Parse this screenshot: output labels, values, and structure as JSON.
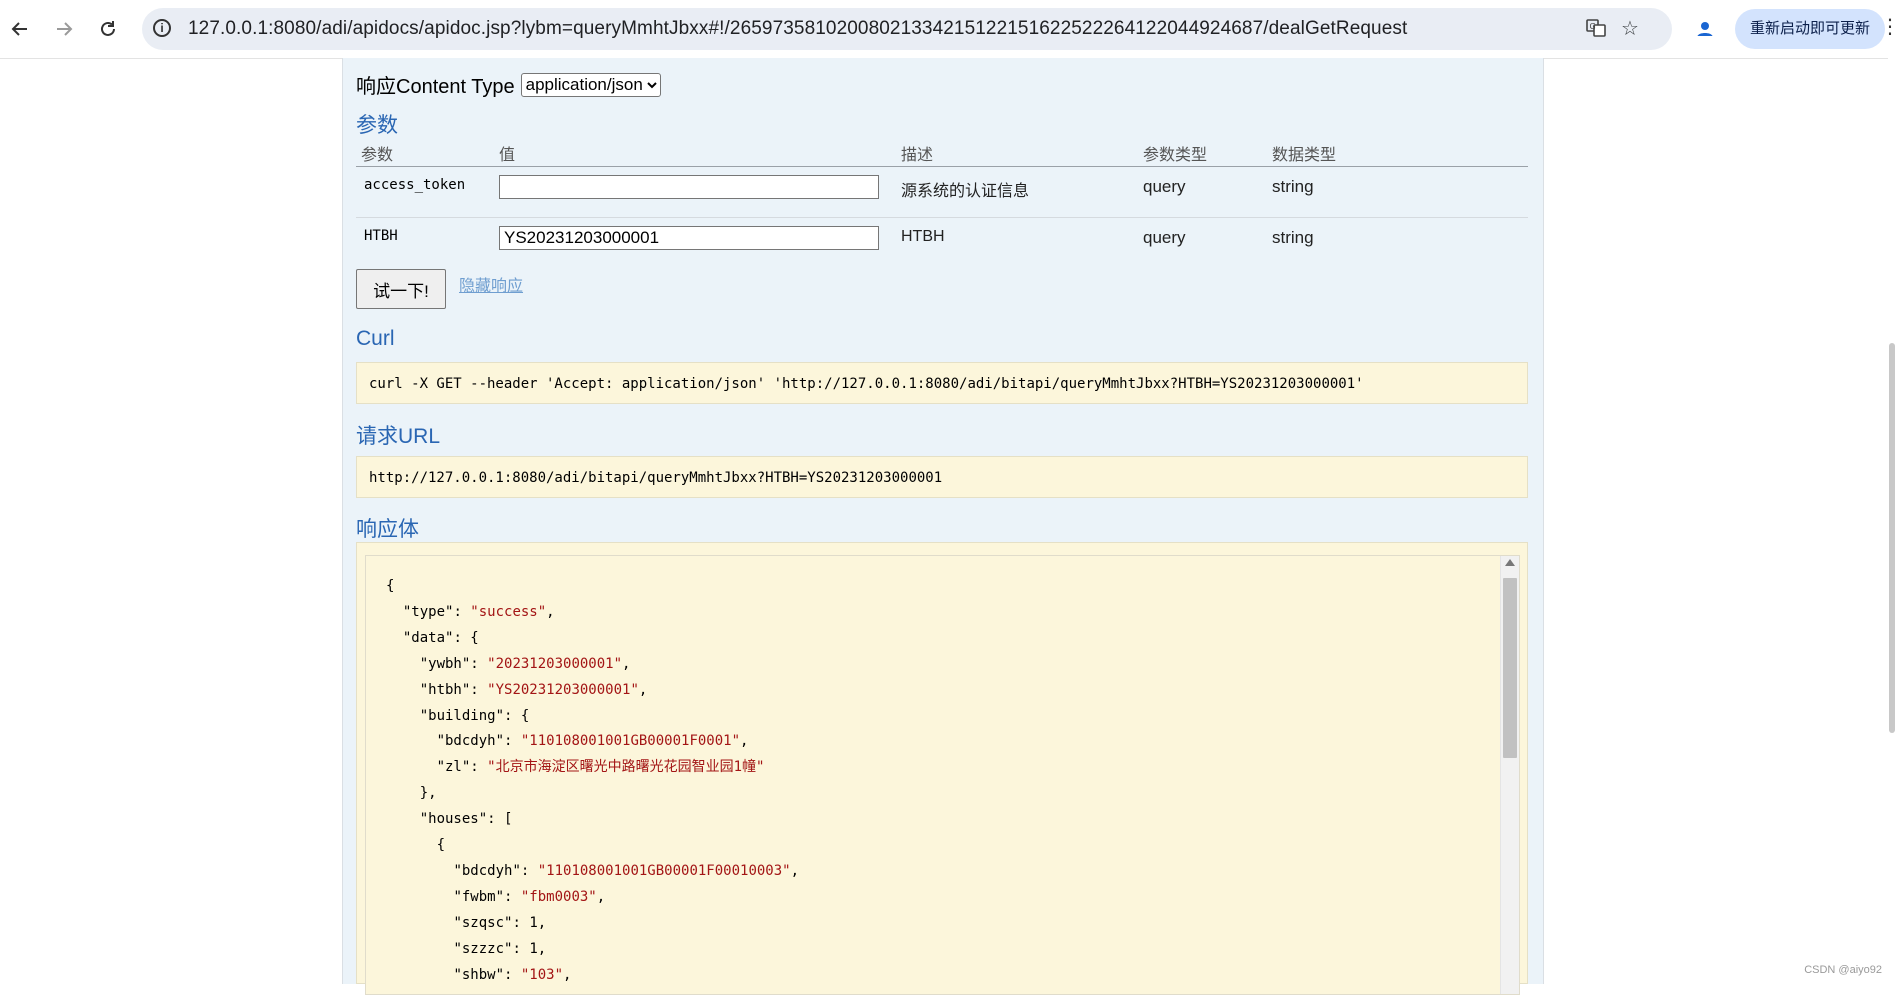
{
  "browser": {
    "url": "127.0.0.1:8080/adi/apidocs/apidoc.jsp?lybm=queryMmhtJbxx#!/26597358102008021334215122151622522264122044924687/dealGetRequest",
    "update_label": "重新启动即可更新",
    "icons": [
      "back-arrow-icon",
      "forward-arrow-icon",
      "reload-icon",
      "site-info-icon",
      "translate-icon",
      "bookmark-star-icon",
      "profile-icon",
      "more-menu-icon"
    ]
  },
  "response_content_type": {
    "label": "响应Content Type",
    "selected": "application/json"
  },
  "params": {
    "heading": "参数",
    "columns": [
      "参数",
      "值",
      "描述",
      "参数类型",
      "数据类型"
    ],
    "rows": [
      {
        "name": "access_token",
        "value": "",
        "desc": "源系统的认证信息",
        "param_type": "query",
        "data_type": "string"
      },
      {
        "name": "HTBH",
        "value": "YS20231203000001",
        "desc": "HTBH",
        "param_type": "query",
        "data_type": "string"
      }
    ]
  },
  "actions": {
    "try_label": "试一下!",
    "hide_response_label": "隐藏响应"
  },
  "curl": {
    "heading": "Curl",
    "command": "curl -X GET --header 'Accept: application/json' 'http://127.0.0.1:8080/adi/bitapi/queryMmhtJbxx?HTBH=YS20231203000001'"
  },
  "request_url": {
    "heading": "请求URL",
    "value": "http://127.0.0.1:8080/adi/bitapi/queryMmhtJbxx?HTBH=YS20231203000001"
  },
  "response_body": {
    "heading": "响应体",
    "lines": [
      {
        "indent": 0,
        "key": "",
        "value": "{",
        "str": false
      },
      {
        "indent": 1,
        "key": "\"type\"",
        "value": "\"success\"",
        "str": true,
        "tail": ","
      },
      {
        "indent": 1,
        "key": "\"data\"",
        "value": "{",
        "str": false
      },
      {
        "indent": 2,
        "key": "\"ywbh\"",
        "value": "\"20231203000001\"",
        "str": true,
        "tail": ","
      },
      {
        "indent": 2,
        "key": "\"htbh\"",
        "value": "\"YS20231203000001\"",
        "str": true,
        "tail": ","
      },
      {
        "indent": 2,
        "key": "\"building\"",
        "value": "{",
        "str": false
      },
      {
        "indent": 3,
        "key": "\"bdcdyh\"",
        "value": "\"110108001001GB00001F0001\"",
        "str": true,
        "tail": ","
      },
      {
        "indent": 3,
        "key": "\"zl\"",
        "value": "\"北京市海淀区曙光中路曙光花园智业园1幢\"",
        "str": true
      },
      {
        "indent": 2,
        "key": "",
        "value": "},",
        "str": false
      },
      {
        "indent": 2,
        "key": "\"houses\"",
        "value": "[",
        "str": false
      },
      {
        "indent": 3,
        "key": "",
        "value": "{",
        "str": false
      },
      {
        "indent": 4,
        "key": "\"bdcdyh\"",
        "value": "\"110108001001GB00001F00010003\"",
        "str": true,
        "tail": ","
      },
      {
        "indent": 4,
        "key": "\"fwbm\"",
        "value": "\"fbm0003\"",
        "str": true,
        "tail": ","
      },
      {
        "indent": 4,
        "key": "\"szqsc\"",
        "value": "1",
        "str": false,
        "tail": ","
      },
      {
        "indent": 4,
        "key": "\"szzzc\"",
        "value": "1",
        "str": false,
        "tail": ","
      },
      {
        "indent": 4,
        "key": "\"shbw\"",
        "value": "\"103\"",
        "str": true,
        "tail": ","
      }
    ]
  },
  "watermark": "CSDN @aiyo92"
}
